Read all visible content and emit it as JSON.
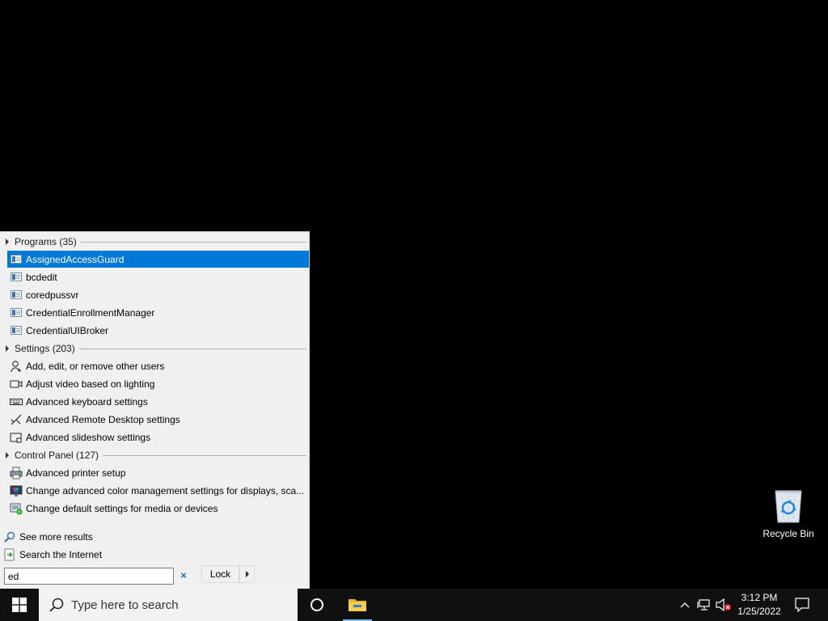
{
  "start_menu": {
    "groups": {
      "programs": {
        "label": "Programs (35)"
      },
      "settings": {
        "label": "Settings (203)"
      },
      "control_panel": {
        "label": "Control Panel (127)"
      }
    },
    "programs": [
      {
        "label": "AssignedAccessGuard",
        "icon": "app-window-icon",
        "selected": true
      },
      {
        "label": "bcdedit",
        "icon": "app-window-icon"
      },
      {
        "label": "coredpussvr",
        "icon": "app-window-icon"
      },
      {
        "label": "CredentialEnrollmentManager",
        "icon": "app-window-icon"
      },
      {
        "label": "CredentialUIBroker",
        "icon": "app-window-icon"
      }
    ],
    "settings": [
      {
        "label": "Add, edit, or remove other users",
        "icon": "user-add-icon"
      },
      {
        "label": "Adjust video based on lighting",
        "icon": "video-icon"
      },
      {
        "label": "Advanced keyboard settings",
        "icon": "keyboard-icon"
      },
      {
        "label": "Advanced Remote Desktop settings",
        "icon": "remote-desktop-icon"
      },
      {
        "label": "Advanced slideshow settings",
        "icon": "slideshow-icon"
      }
    ],
    "control_panel": [
      {
        "label": "Advanced printer setup",
        "icon": "printer-icon"
      },
      {
        "label": "Change advanced color management settings for displays, sca...",
        "icon": "color-management-icon"
      },
      {
        "label": "Change default settings for media or devices",
        "icon": "autoplay-icon"
      }
    ],
    "see_more": "See more results",
    "search_internet": "Search the Internet",
    "search_value": "ed",
    "clear_label": "×",
    "lock_label": "Lock"
  },
  "desktop": {
    "recycle_bin_label": "Recycle Bin"
  },
  "taskbar": {
    "search_placeholder": "Type here to search",
    "time": "3:12 PM",
    "date": "1/25/2022"
  },
  "colors": {
    "selection": "#0078d7",
    "taskbar": "#101010",
    "menu_background": "#f0f0f0"
  }
}
